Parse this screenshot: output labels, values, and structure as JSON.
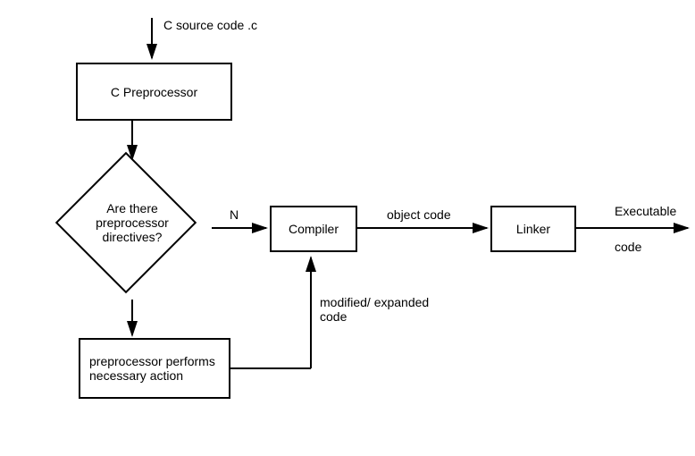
{
  "diagram": {
    "input_label": "C source code .c",
    "preprocessor_box": "C Preprocessor",
    "decision": "Are there preprocessor directives?",
    "decision_no": "N",
    "compiler_box": "Compiler",
    "object_code_label": "object code",
    "linker_box": "Linker",
    "executable_label_top": "Executable",
    "executable_label_bottom": "code",
    "action_box": "preprocessor performs necessary action",
    "modified_label": "modified/ expanded code"
  }
}
